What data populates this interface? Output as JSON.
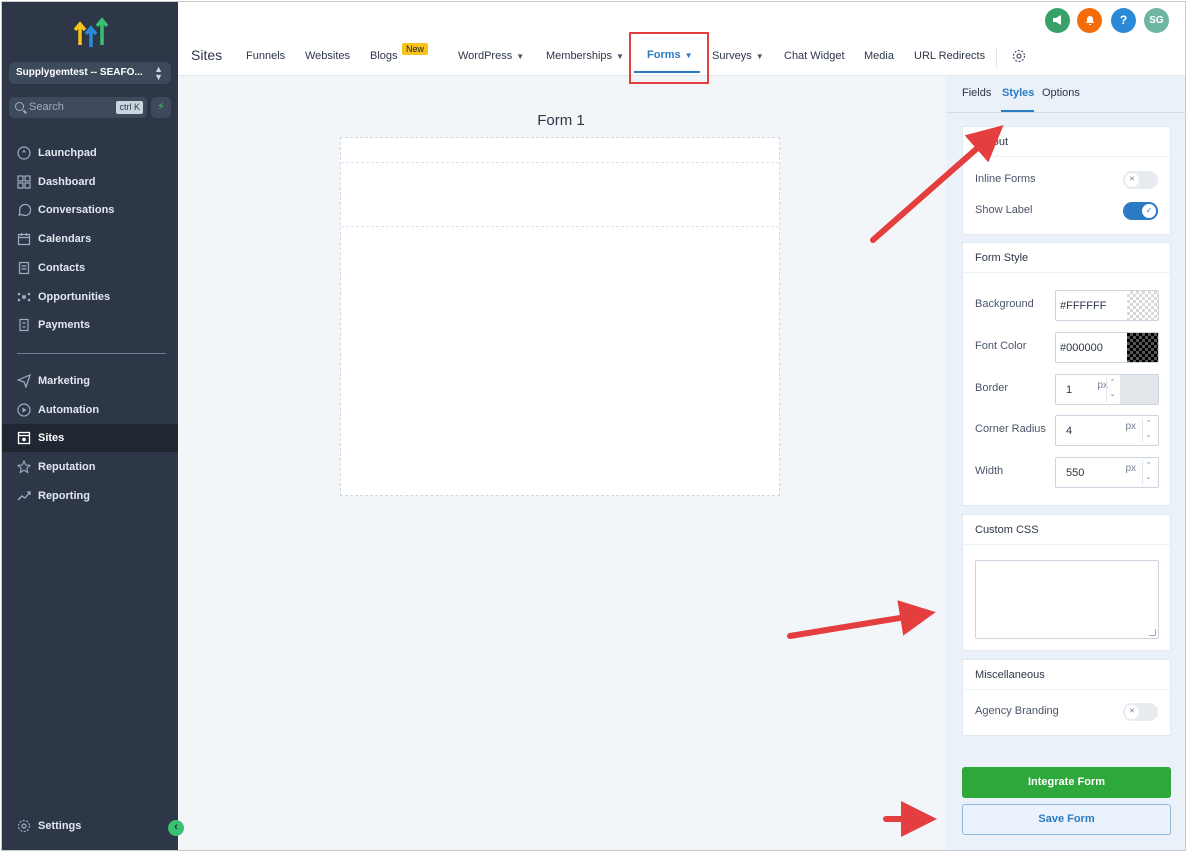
{
  "sidebar": {
    "account": "Supplygemtest -- SEAFO...",
    "search_label": "Search",
    "search_shortcut": "ctrl K",
    "items_top": [
      {
        "label": "Launchpad",
        "icon": "rocket-icon"
      },
      {
        "label": "Dashboard",
        "icon": "grid-icon"
      },
      {
        "label": "Conversations",
        "icon": "chat-icon"
      },
      {
        "label": "Calendars",
        "icon": "calendar-icon"
      },
      {
        "label": "Contacts",
        "icon": "contacts-icon"
      },
      {
        "label": "Opportunities",
        "icon": "opportunities-icon"
      },
      {
        "label": "Payments",
        "icon": "payments-icon"
      }
    ],
    "items_bottom": [
      {
        "label": "Marketing",
        "icon": "send-icon"
      },
      {
        "label": "Automation",
        "icon": "automation-icon"
      },
      {
        "label": "Sites",
        "icon": "sites-icon"
      },
      {
        "label": "Reputation",
        "icon": "star-icon"
      },
      {
        "label": "Reporting",
        "icon": "trend-icon"
      }
    ],
    "settings_label": "Settings"
  },
  "topbar": {
    "title": "Sites",
    "tabs": {
      "funnels": "Funnels",
      "websites": "Websites",
      "blogs": "Blogs",
      "blogs_badge": "New",
      "wordpress": "WordPress",
      "memberships": "Memberships",
      "forms": "Forms",
      "surveys": "Surveys",
      "chat_widget": "Chat Widget",
      "media": "Media",
      "url_redirects": "URL Redirects"
    },
    "avatar_initials": "SG",
    "help_glyph": "?",
    "colors": {
      "announce": "#38a169",
      "notify": "#f56c0a",
      "help": "#2b8ad8",
      "avatar": "#6fb5a3"
    }
  },
  "canvas": {
    "form_title": "Form 1"
  },
  "panel": {
    "tabs": {
      "fields": "Fields",
      "styles": "Styles",
      "options": "Options"
    },
    "layout": {
      "title": "Layout",
      "inline_forms": "Inline Forms",
      "show_label": "Show Label"
    },
    "form_style": {
      "title": "Form Style",
      "background_label": "Background",
      "background_value": "#FFFFFF",
      "font_color_label": "Font Color",
      "font_color_value": "#000000",
      "border_label": "Border",
      "border_value": "1",
      "corner_radius_label": "Corner Radius",
      "corner_radius_value": "4",
      "width_label": "Width",
      "width_value": "550",
      "unit": "px"
    },
    "custom_css": {
      "title": "Custom CSS"
    },
    "misc": {
      "title": "Miscellaneous",
      "agency_branding": "Agency Branding"
    },
    "integrate_button": "Integrate Form",
    "save_button": "Save Form"
  }
}
